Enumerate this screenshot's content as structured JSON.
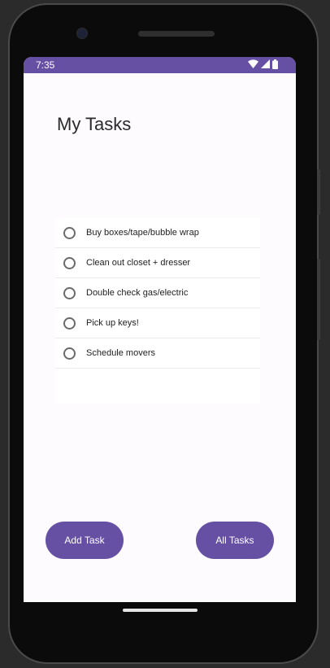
{
  "status_bar": {
    "time": "7:35",
    "icons": [
      "wifi-icon",
      "cellular-signal-icon",
      "battery-icon"
    ]
  },
  "header": {
    "title": "My Tasks"
  },
  "tasks": {
    "items": [
      {
        "label": "Buy boxes/tape/bubble wrap",
        "checked": false
      },
      {
        "label": "Clean out closet + dresser",
        "checked": false
      },
      {
        "label": "Double check gas/electric",
        "checked": false
      },
      {
        "label": "Pick up keys!",
        "checked": false
      },
      {
        "label": "Schedule movers",
        "checked": false
      }
    ]
  },
  "actions": {
    "add_task_label": "Add Task",
    "all_tasks_label": "All Tasks"
  },
  "colors": {
    "accent": "#6650a4",
    "status_bar": "#6550a4",
    "screen_background": "#fefbff"
  }
}
